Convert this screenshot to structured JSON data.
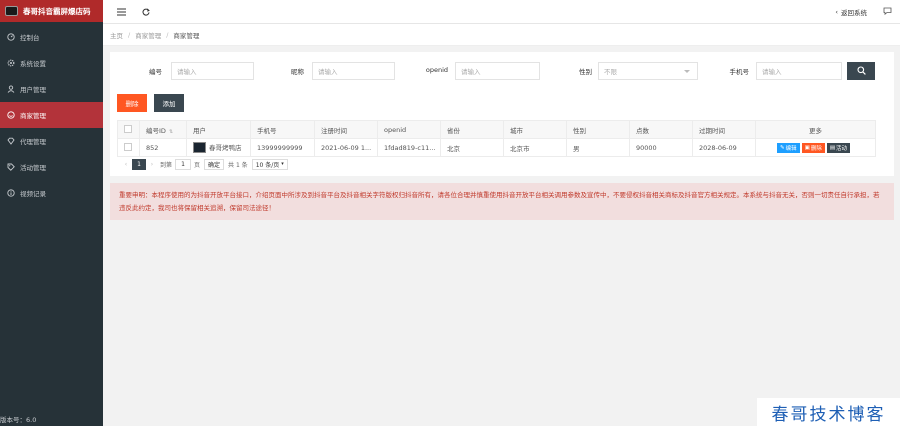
{
  "brand": {
    "title": "春哥抖音霸屏爆店码"
  },
  "sidebar": {
    "items": [
      {
        "label": "控制台",
        "icon": "dashboard-icon"
      },
      {
        "label": "系统设置",
        "icon": "gear-icon"
      },
      {
        "label": "用户管理",
        "icon": "user-icon"
      },
      {
        "label": "商家管理",
        "icon": "smile-icon",
        "active": true
      },
      {
        "label": "代理管理",
        "icon": "diamond-icon"
      },
      {
        "label": "活动管理",
        "icon": "tag-icon"
      },
      {
        "label": "视频记录",
        "icon": "info-icon"
      }
    ],
    "version": "版本号：6.0"
  },
  "topbar": {
    "back_label": "返回系统"
  },
  "breadcrumb": {
    "home": "主页",
    "parent": "商家管理",
    "current": "商家管理"
  },
  "filters": {
    "id_label": "编号",
    "id_placeholder": "请输入",
    "nickname_label": "昵称",
    "nickname_placeholder": "请输入",
    "openid_label": "openid",
    "openid_placeholder": "请输入",
    "gender_label": "性别",
    "gender_value": "不限",
    "phone_label": "手机号",
    "phone_placeholder": "请输入"
  },
  "actions": {
    "delete_label": "删除",
    "add_label": "添加"
  },
  "table": {
    "headers": {
      "id": "编号ID",
      "user": "用户",
      "phone": "手机号",
      "reg_time": "注册时间",
      "openid": "openid",
      "province": "省份",
      "city": "城市",
      "gender": "性别",
      "points": "点数",
      "expire": "过期时间",
      "more": "更多"
    },
    "rows": [
      {
        "id": "852",
        "user": "春哥烤鸭店",
        "phone": "13999999999",
        "reg_time": "2021-06-09 1...",
        "openid": "1fdad819-c11...",
        "province": "北京",
        "city": "北京市",
        "gender": "男",
        "points": "90000",
        "expire": "2028-06-09",
        "edit": "编辑",
        "del": "删除",
        "activity": "活动"
      }
    ]
  },
  "pager": {
    "current": "1",
    "goto_label": "到第",
    "page_value": "1",
    "page_unit": "页",
    "confirm": "确定",
    "total": "共 1 条",
    "size": "10 条/页"
  },
  "notice": {
    "text": "重要申明：本程序使用的为抖音开放平台接口，介绍页面中所涉及到抖音平台及抖音相关字符版权归抖音所有，请各位合理并慎重使用抖音开放平台相关调用参数及宣传中，不要侵权抖音相关商标及抖音官方相关规定。本系统与抖音无关，否则一切责任自行承担，若违反此约定，我司也将保留相关追溯，保留司法途径！"
  },
  "watermark": "春哥技术博客"
}
